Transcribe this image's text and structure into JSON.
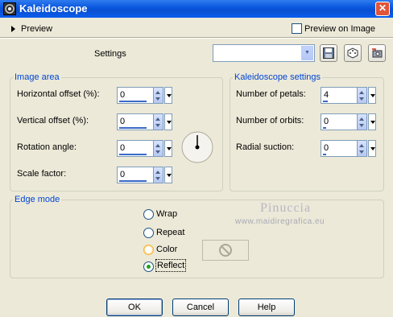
{
  "window": {
    "title": "Kaleidoscope",
    "close_glyph": "✕"
  },
  "preview": {
    "label": "Preview",
    "preview_on_image_label": "Preview on Image",
    "preview_on_image_checked": false
  },
  "settings": {
    "label": "Settings",
    "preset_value": ""
  },
  "image_area": {
    "legend": "Image area",
    "horizontal_offset": {
      "label": "Horizontal offset (%):",
      "value": "0"
    },
    "vertical_offset": {
      "label": "Vertical offset (%):",
      "value": "0"
    },
    "rotation_angle": {
      "label": "Rotation angle:",
      "value": "0"
    },
    "scale_factor": {
      "label": "Scale factor:",
      "value": "0"
    }
  },
  "kaleidoscope_settings": {
    "legend": "Kaleidoscope settings",
    "number_of_petals": {
      "label": "Number of petals:",
      "value": "4"
    },
    "number_of_orbits": {
      "label": "Number of orbits:",
      "value": "0"
    },
    "radial_suction": {
      "label": "Radial suction:",
      "value": "0"
    }
  },
  "edge_mode": {
    "legend": "Edge mode",
    "options": [
      "Wrap",
      "Repeat",
      "Color",
      "Reflect"
    ],
    "selected": "Reflect"
  },
  "watermark": {
    "name": "Pinuccia",
    "url": "www.maidiregrafica.eu"
  },
  "buttons": {
    "ok": "OK",
    "cancel": "Cancel",
    "help": "Help"
  }
}
